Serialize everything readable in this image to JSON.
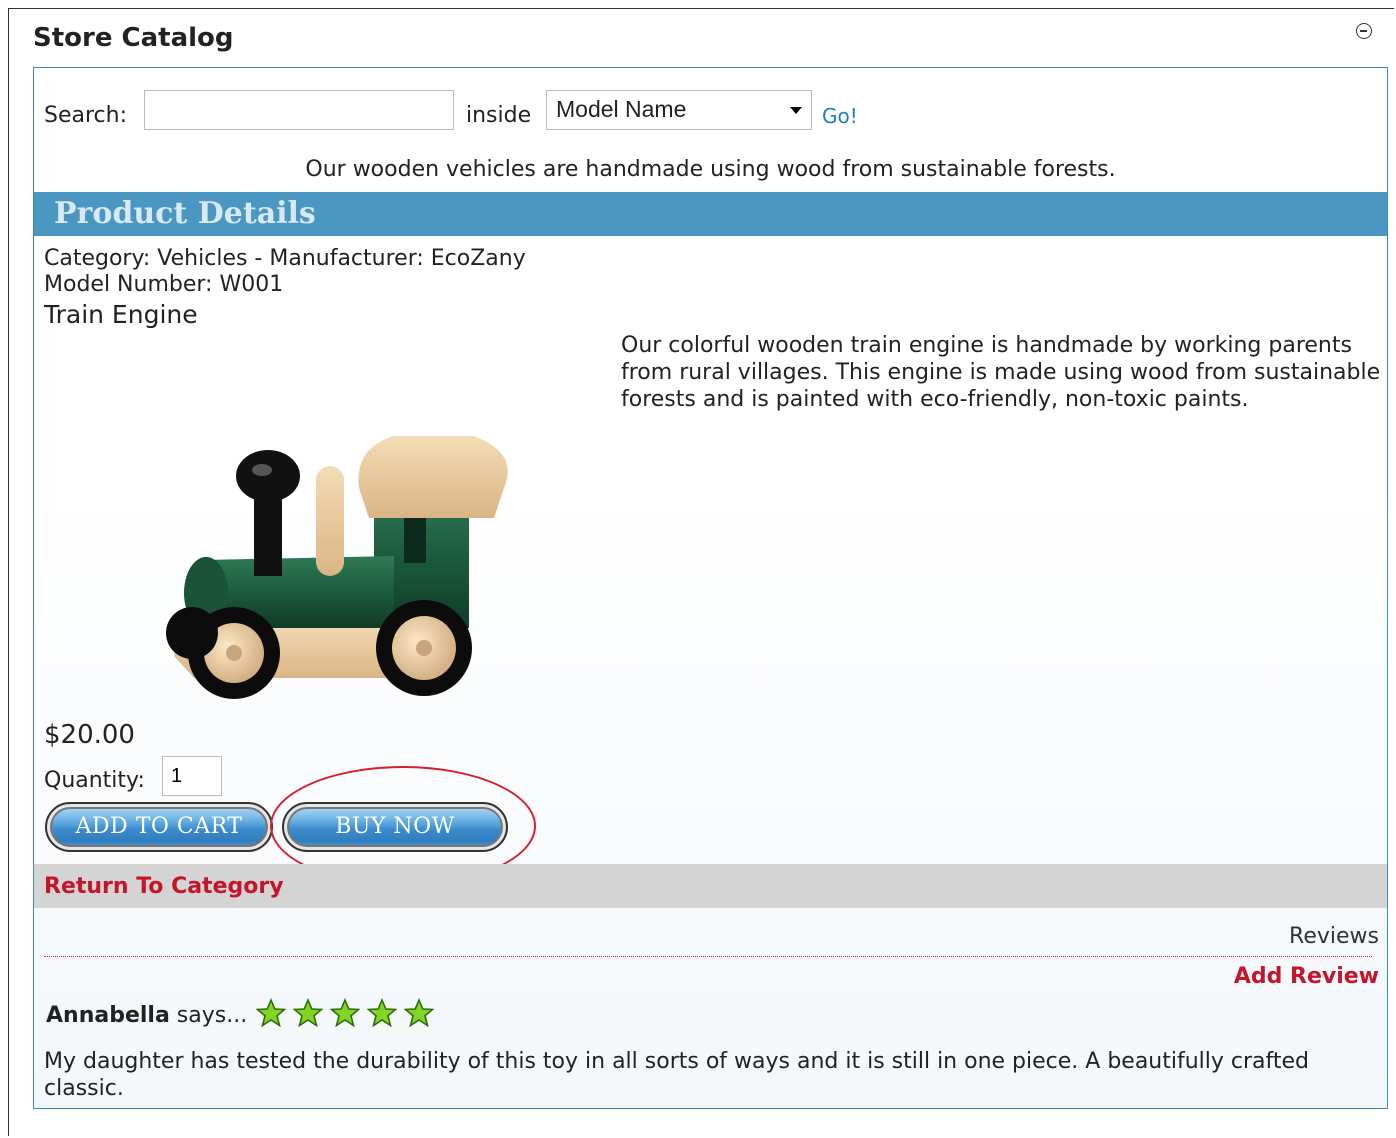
{
  "module": {
    "title": "Store Catalog"
  },
  "search": {
    "label": "Search:",
    "value": "",
    "inside_label": "inside",
    "selected_field": "Model Name",
    "go_label": "Go!"
  },
  "intro": "Our wooden vehicles are handmade using wood from sustainable forests.",
  "section": {
    "title": "Product Details"
  },
  "product": {
    "category_line": "Category: Vehicles - Manufacturer: EcoZany",
    "model_line": "Model Number: W001",
    "name": "Train Engine",
    "description": "Our colorful wooden train engine is handmade by working parents from rural villages. This engine is made using wood from sustainable forests and is painted with eco-friendly, non-toxic paints.",
    "price": "$20.00",
    "quantity_label": "Quantity:",
    "quantity_value": "1"
  },
  "buttons": {
    "add_to_cart": "ADD TO CART",
    "buy_now": "BUY NOW"
  },
  "return_link": "Return To Category",
  "reviews": {
    "label": "Reviews",
    "add_label": "Add Review",
    "items": [
      {
        "author": "Annabella",
        "says": " says...",
        "rating": 5,
        "text": "My daughter has tested the durability of this toy in all sorts of ways and it is still in one piece. A beautifully crafted classic."
      }
    ]
  },
  "colors": {
    "accent_blue": "#4a97c2",
    "link_red": "#c4152a",
    "link_blue": "#1f7ec2",
    "star_green": "#7fd625"
  }
}
